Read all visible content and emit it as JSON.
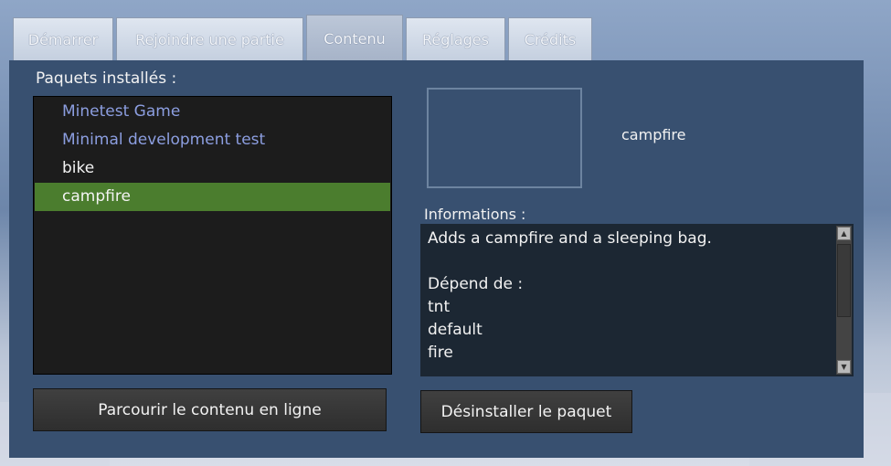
{
  "tabs": [
    {
      "label": "Démarrer"
    },
    {
      "label": "Rejoindre une partie"
    },
    {
      "label": "Contenu"
    },
    {
      "label": "Réglages"
    },
    {
      "label": "Crédits"
    }
  ],
  "active_tab": "Contenu",
  "packages": {
    "label": "Paquets installés :",
    "items": [
      {
        "name": "Minetest Game",
        "type": "modpack"
      },
      {
        "name": "Minimal development test",
        "type": "modpack"
      },
      {
        "name": "bike",
        "type": "mod"
      },
      {
        "name": "campfire",
        "type": "mod",
        "selected": true
      }
    ]
  },
  "details": {
    "title": "campfire",
    "info_label": "Informations :",
    "description": "Adds a campfire and a sleeping bag.",
    "depends_label": "Dépend de :",
    "depends": [
      "tnt",
      "default",
      "fire"
    ]
  },
  "buttons": {
    "browse": "Parcourir le contenu en ligne",
    "uninstall": "Désinstaller le paquet"
  },
  "colors": {
    "panel": "#385070",
    "selected": "#4b7d2e",
    "modpack_text": "#8c9ee0"
  }
}
